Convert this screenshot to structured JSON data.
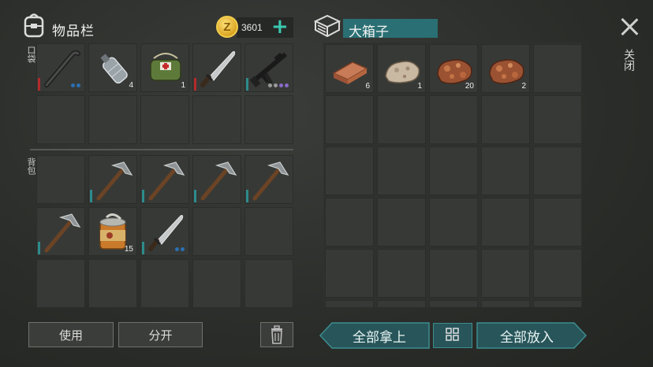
{
  "inventory": {
    "title": "物品栏",
    "coins": "3601",
    "pocket_label": "口袋",
    "backpack_label": "背包",
    "pocket_items": [
      {
        "name": "crowbar",
        "count": "",
        "bar": "#b22a2a",
        "dots": [
          "#2b6fb0",
          "#2b6fb0"
        ]
      },
      {
        "name": "water-bottle",
        "count": "4"
      },
      {
        "name": "first-aid-kit",
        "count": "1"
      },
      {
        "name": "machete",
        "count": "",
        "bar": "#b22a2a"
      },
      {
        "name": "assault-rifle",
        "count": "",
        "bar": "#2d8b8c",
        "dots": [
          "#9a9a9a",
          "#9a9a9a",
          "#8a6ac8",
          "#8a6ac8"
        ]
      }
    ],
    "backpack_items": [
      {
        "name": "empty",
        "count": ""
      },
      {
        "name": "pickaxe",
        "count": "",
        "bar": "#2d8b8c"
      },
      {
        "name": "pickaxe",
        "count": "",
        "bar": "#2d8b8c"
      },
      {
        "name": "pickaxe",
        "count": "",
        "bar": "#2d8b8c"
      },
      {
        "name": "pickaxe",
        "count": "",
        "bar": "#2d8b8c"
      },
      {
        "name": "pickaxe",
        "count": "",
        "bar": "#2d8b8c"
      },
      {
        "name": "canned-food",
        "count": "15"
      },
      {
        "name": "machete",
        "count": "",
        "bar": "#2d8b8c",
        "dots": [
          "#2b6fb0",
          "#2b6fb0"
        ]
      }
    ]
  },
  "box": {
    "title": "大箱子",
    "items": [
      {
        "name": "copper-ingot",
        "count": "6"
      },
      {
        "name": "stone",
        "count": "1"
      },
      {
        "name": "copper-ore",
        "count": "20"
      },
      {
        "name": "copper-ore",
        "count": "2"
      }
    ]
  },
  "buttons": {
    "use": "使用",
    "split": "分开",
    "take_all": "全部拿上",
    "put_all": "全部放入",
    "close": "关闭"
  },
  "colors": {
    "accent": "#2a6f73",
    "durability_red": "#b22a2a",
    "durability_teal": "#2d8b8c"
  }
}
